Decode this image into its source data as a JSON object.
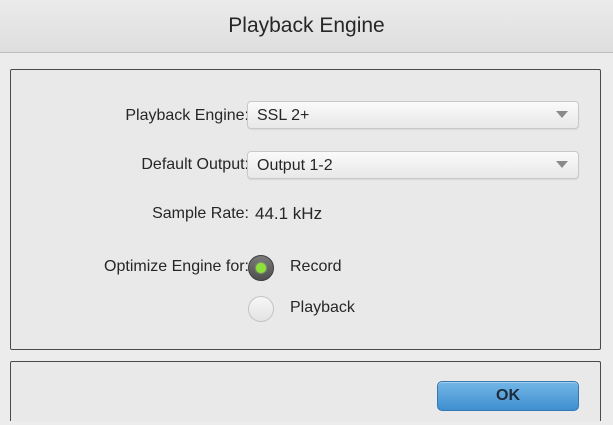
{
  "window": {
    "title": "Playback Engine"
  },
  "settings": {
    "playback_engine": {
      "label": "Playback Engine:",
      "value": "SSL 2+"
    },
    "default_output": {
      "label": "Default Output:",
      "value": "Output 1-2"
    },
    "sample_rate": {
      "label": "Sample Rate:",
      "value": "44.1 kHz"
    },
    "optimize": {
      "label": "Optimize Engine for:",
      "options": [
        {
          "label": "Record",
          "selected": true
        },
        {
          "label": "Playback",
          "selected": false
        }
      ]
    }
  },
  "footer": {
    "ok_label": "OK"
  },
  "colors": {
    "accent_button": "#4f9ad6",
    "radio_active_dot": "#8de23a"
  }
}
